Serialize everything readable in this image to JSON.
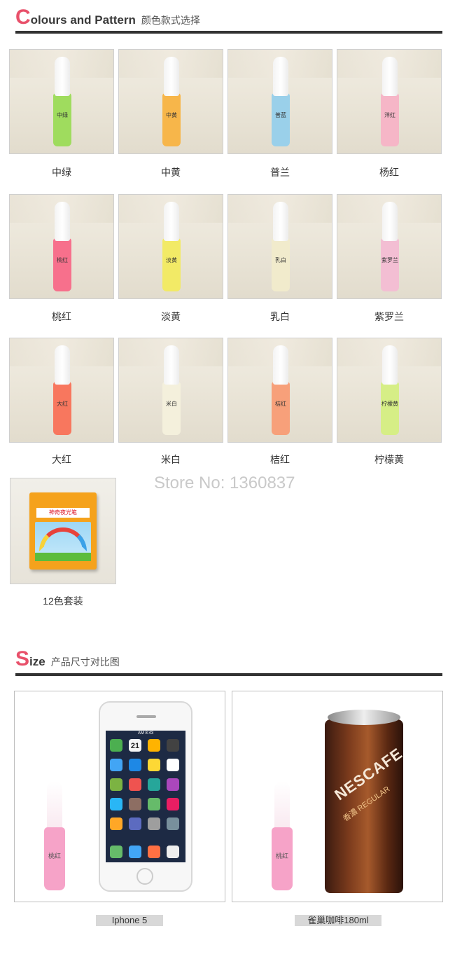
{
  "section1": {
    "big_letter": "C",
    "rest": "olours and Pattern",
    "subtitle": "颜色款式选择"
  },
  "colors": [
    {
      "caption": "中绿",
      "stick_label": "中绿",
      "color": "#9fdc5e"
    },
    {
      "caption": "中黄",
      "stick_label": "中黄",
      "color": "#f7b64a"
    },
    {
      "caption": "普兰",
      "stick_label": "普蓝",
      "color": "#9ad0ea"
    },
    {
      "caption": "杨红",
      "stick_label": "洋红",
      "color": "#f6b6c7"
    },
    {
      "caption": "桃红",
      "stick_label": "桃红",
      "color": "#f7708c"
    },
    {
      "caption": "淡黄",
      "stick_label": "淡黄",
      "color": "#f2ea66"
    },
    {
      "caption": "乳白",
      "stick_label": "乳白",
      "color": "#f1ebcc"
    },
    {
      "caption": "紫罗兰",
      "stick_label": "紫罗兰",
      "color": "#f3bed3"
    },
    {
      "caption": "大红",
      "stick_label": "大红",
      "color": "#f8775e"
    },
    {
      "caption": "米白",
      "stick_label": "米白",
      "color": "#f4f0dc"
    },
    {
      "caption": "桔红",
      "stick_label": "桔红",
      "color": "#f7a07a"
    },
    {
      "caption": "柠檬黄",
      "stick_label": "柠檬黄",
      "color": "#d6ee86"
    }
  ],
  "set": {
    "caption": "12色套装",
    "box_label": "神奇夜光笔"
  },
  "store_text": "Store No: 1360837",
  "section2": {
    "big_letter": "S",
    "rest": "ize",
    "subtitle": "产品尺寸对比图"
  },
  "compare": [
    {
      "caption": "Iphone 5",
      "pen_label": "桃红",
      "time": "AM 8:43",
      "date": "21"
    },
    {
      "caption": "雀巢咖啡180ml",
      "pen_label": "桃红",
      "brand": "NESCAFE",
      "brand_sub": "香濃 REGULAR"
    }
  ]
}
